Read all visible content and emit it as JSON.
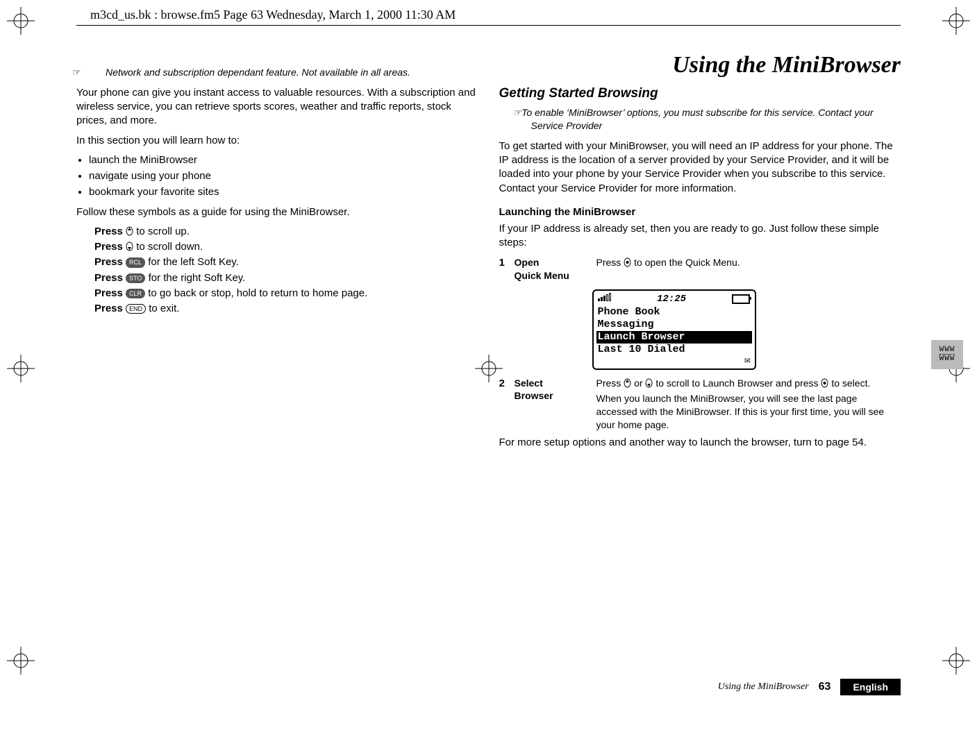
{
  "running_header": "m3cd_us.bk : browse.fm5  Page 63  Wednesday, March 1, 2000  11:30 AM",
  "title": "Using the MiniBrowser",
  "left": {
    "note": "Network and subscription dependant feature. Not available in all areas.",
    "intro1": "Your phone can give you instant access to valuable resources. With a subscription and wireless service, you can retrieve sports scores, weather and traffic reports, stock prices, and more.",
    "intro2": "In this section you will learn how to:",
    "bullets": [
      "launch the MiniBrowser",
      "navigate using your phone",
      "bookmark your favorite sites"
    ],
    "follow": "Follow these symbols as a guide for using the MiniBrowser.",
    "press": {
      "label": "Press",
      "up": " to scroll up.",
      "down": " to scroll down.",
      "left": " for the left Soft Key.",
      "right": " for the right Soft Key.",
      "clr": " to go back or stop, hold to return to home page.",
      "end": " to exit."
    },
    "keys": {
      "rcl": "RCL",
      "sto": "STO",
      "clr": "CLR",
      "end": "END"
    }
  },
  "right": {
    "section": "Getting Started Browsing",
    "note": "To enable ‘MiniBrowser’ options, you must subscribe for this service. Contact your Service Provider",
    "para": "To get started with your MiniBrowser, you will need an IP address for your phone. The IP address is the location of a server provided by your Service Provider, and it will be loaded into your phone by your Service Provider when you subscribe to this service. Contact your Service Provider for more information.",
    "subhead": "Launching the MiniBrowser",
    "sub_para": "If your IP address is already set, then you are ready to go. Just follow these simple steps:",
    "steps": [
      {
        "num": "1",
        "label_l1": "Open",
        "label_l2": "Quick Menu",
        "body": "Press   to open the Quick Menu."
      },
      {
        "num": "2",
        "label_l1": "Select",
        "label_l2": "Browser",
        "body1_a": "Press ",
        "body1_b": " or ",
        "body1_c": " to scroll to Launch Browser and press ",
        "body1_d": " to select.",
        "body2": "When you launch the MiniBrowser, you will see the last page accessed with the MiniBrowser. If this is your first time, you will see your home page."
      }
    ],
    "screen": {
      "time": "12:25",
      "lines": [
        "Phone Book",
        "Messaging",
        "Launch Browser",
        "Last 10 Dialed"
      ],
      "highlight_index": 2
    },
    "closing": "For more setup options and another way to launch the browser, turn to page 54."
  },
  "footer": {
    "title": "Using the MiniBrowser",
    "page": "63",
    "lang": "English"
  },
  "thumbtab": {
    "l1": "WWW",
    "l2": "WWW"
  }
}
